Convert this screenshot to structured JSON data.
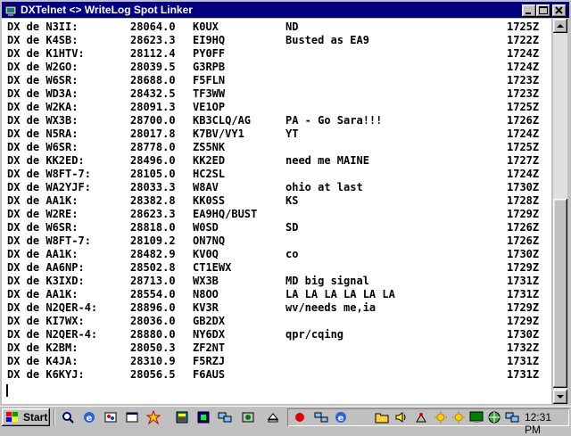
{
  "window": {
    "title": "DXTelnet <> WriteLog Spot Linker"
  },
  "spots": [
    {
      "call": "DX de N3II:",
      "freq": "28064.0",
      "dx": "K0UX",
      "note": "ND",
      "time": "1725Z"
    },
    {
      "call": "DX de K4SB:",
      "freq": "28623.3",
      "dx": "EI9HQ",
      "note": "Busted as EA9",
      "time": "1722Z"
    },
    {
      "call": "DX de K1HTV:",
      "freq": "28112.4",
      "dx": "PY0FF",
      "note": "",
      "time": "1724Z"
    },
    {
      "call": "DX de W2GO:",
      "freq": "28039.5",
      "dx": "G3RPB",
      "note": "",
      "time": "1724Z"
    },
    {
      "call": "DX de W6SR:",
      "freq": "28688.0",
      "dx": "F5FLN",
      "note": "",
      "time": "1723Z"
    },
    {
      "call": "DX de WD3A:",
      "freq": "28432.5",
      "dx": "TF3WW",
      "note": "",
      "time": "1723Z"
    },
    {
      "call": "DX de W2KA:",
      "freq": "28091.3",
      "dx": "VE1OP",
      "note": "",
      "time": "1725Z"
    },
    {
      "call": "DX de WX3B:",
      "freq": "28700.0",
      "dx": "KB3CLQ/AG",
      "note": "PA - Go Sara!!!",
      "time": "1726Z"
    },
    {
      "call": "DX de N5RA:",
      "freq": "28017.8",
      "dx": "K7BV/VY1",
      "note": "YT",
      "time": "1724Z"
    },
    {
      "call": "DX de W6SR:",
      "freq": "28778.0",
      "dx": "ZS5NK",
      "note": "",
      "time": "1725Z"
    },
    {
      "call": "DX de KK2ED:",
      "freq": "28496.0",
      "dx": "KK2ED",
      "note": "need me MAINE",
      "time": "1727Z"
    },
    {
      "call": "DX de W8FT-7:",
      "freq": "28105.0",
      "dx": "HC2SL",
      "note": "",
      "time": "1724Z"
    },
    {
      "call": "DX de WA2YJF:",
      "freq": "28033.3",
      "dx": "W8AV",
      "note": "ohio at last",
      "time": "1730Z"
    },
    {
      "call": "DX de AA1K:",
      "freq": "28382.8",
      "dx": "KK0SS",
      "note": "KS",
      "time": "1728Z"
    },
    {
      "call": "DX de W2RE:",
      "freq": "28623.3",
      "dx": "EA9HQ/BUST",
      "note": "",
      "time": "1729Z"
    },
    {
      "call": "DX de W6SR:",
      "freq": "28818.0",
      "dx": "W0SD",
      "note": "SD",
      "time": "1726Z"
    },
    {
      "call": "DX de W8FT-7:",
      "freq": "28109.2",
      "dx": "ON7NQ",
      "note": "",
      "time": "1726Z"
    },
    {
      "call": "DX de AA1K:",
      "freq": "28482.9",
      "dx": "KV0Q",
      "note": "co",
      "time": "1730Z"
    },
    {
      "call": "DX de AA6NP:",
      "freq": "28502.8",
      "dx": "CT1EWX",
      "note": "",
      "time": "1729Z"
    },
    {
      "call": "DX de K3IXD:",
      "freq": "28713.0",
      "dx": "WX3B",
      "note": "MD big signal",
      "time": "1731Z"
    },
    {
      "call": "DX de AA1K:",
      "freq": "28554.0",
      "dx": "N8OO",
      "note": "LA LA LA LA LA LA",
      "time": "1731Z"
    },
    {
      "call": "DX de N2QER-4:",
      "freq": "28896.0",
      "dx": "KV3R",
      "note": "wv/needs me,ia",
      "time": "1729Z"
    },
    {
      "call": "DX de KI7WX:",
      "freq": "28036.0",
      "dx": "GB2DX",
      "note": "",
      "time": "1729Z"
    },
    {
      "call": "DX de N2QER-4:",
      "freq": "28880.0",
      "dx": "NY6DX",
      "note": "qpr/cqing",
      "time": "1730Z"
    },
    {
      "call": "DX de K2BM:",
      "freq": "28050.3",
      "dx": "ZF2NT",
      "note": "",
      "time": "1732Z"
    },
    {
      "call": "DX de K4JA:",
      "freq": "28310.9",
      "dx": "F5RZJ",
      "note": "",
      "time": "1731Z"
    },
    {
      "call": "DX de K6KYJ:",
      "freq": "28056.5",
      "dx": "F6AUS",
      "note": "",
      "time": "1731Z"
    }
  ],
  "scrollbar": {
    "position_fraction": 0.48
  },
  "taskbar": {
    "start_label": "Start",
    "clock": "12:31 PM",
    "quick_icons": [
      "magnifier-icon",
      "ie-icon",
      "paint-icon",
      "window-icon",
      "burst-icon",
      "app-icon",
      "app-icon-2",
      "network-icon",
      "media-icon",
      "eject-icon"
    ],
    "tray_icons": [
      "red-icon",
      "network-icon",
      "ie-icon",
      "folder-icon",
      "speaker-icon",
      "satellite-icon",
      "sun-icon",
      "sun-icon-2",
      "display-icon",
      "globe-icon",
      "network-monitor-icon"
    ]
  },
  "colors": {
    "titlebar": "#000080",
    "face": "#c0c0c0",
    "terminal_bg": "#ffffff"
  }
}
